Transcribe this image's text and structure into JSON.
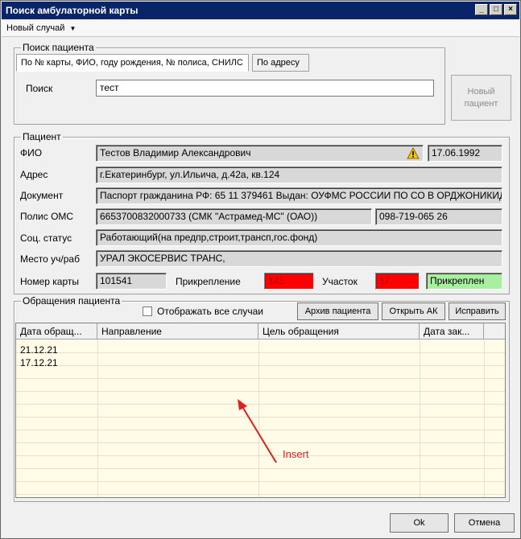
{
  "window": {
    "title": "Поиск амбулаторной карты"
  },
  "menu": {
    "new_case": "Новый случай"
  },
  "search": {
    "group_title": "Поиск пациента",
    "tab_main": "По № карты, ФИО, году рождения, № полиса, СНИЛС",
    "tab_address": "По адресу",
    "label": "Поиск",
    "value": "тест",
    "new_patient_line1": "Новый",
    "new_patient_line2": "пациент"
  },
  "patient": {
    "group_title": "Пациент",
    "fio_label": "ФИО",
    "fio_value": "Тестов Владимир Александрович",
    "birth_date": "17.06.1992",
    "address_label": "Адрес",
    "address_value": "г.Екатеринбург, ул.Ильича, д.42а, кв.124",
    "document_label": "Документ",
    "document_value": "Паспорт гражданина РФ: 65 11 379461 Выдан: ОУФМС РОССИИ ПО СО В ОРДЖОНИКИДЗЕВСКОМ",
    "policy_label": "Полис ОМС",
    "policy_value": "6653700832000733 (СМК \"Астрамед-МС\" (ОАО))",
    "snils_value": "098-719-065 26",
    "social_label": "Соц. статус",
    "social_value": "Работающий(на предпр,строит,трансп,гос.фонд)",
    "work_label": "Место уч/раб",
    "work_value": "УРАЛ ЭКОСЕРВИС ТРАНС,",
    "card_label": "Номер карты",
    "card_value": "101541",
    "attach_label": "Прикрепление",
    "attach_value": "145",
    "district_label": "Участок",
    "district_value": "17",
    "attach_status": "Прикреплен"
  },
  "visits": {
    "group_title": "Обращения пациента",
    "show_all_label": "Отображать все случаи",
    "archive_button": "Архив пациента",
    "open_ak_button": "Открыть АК",
    "fix_button": "Исправить",
    "columns": [
      "Дата обращ...",
      "Направление",
      "Цель обращения",
      "Дата зак..."
    ],
    "rows": [
      {
        "date": "21.12.21"
      },
      {
        "date": "17.12.21"
      }
    ]
  },
  "annotation": {
    "text": "Insert",
    "color": "#e02020"
  },
  "footer": {
    "ok": "Ok",
    "cancel": "Отмена"
  },
  "colors": {
    "title_bar": "#0a246a",
    "attach_bg": "#ff0000",
    "attached_bg": "#a8f0a0",
    "grid_bg": "#fffbe6"
  }
}
